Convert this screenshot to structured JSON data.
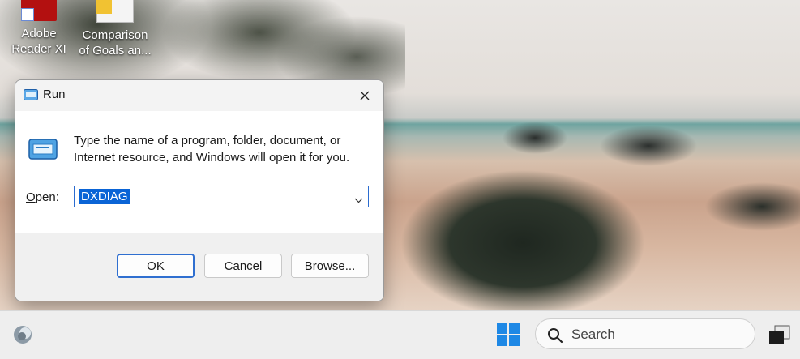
{
  "desktop": {
    "icons": [
      {
        "label_line1": "Adobe",
        "label_line2": "Reader XI",
        "icon": "pdf-file-icon"
      },
      {
        "label_line1": "Comparison",
        "label_line2": "of Goals an...",
        "icon": "spreadsheet-file-icon"
      }
    ]
  },
  "run_dialog": {
    "title": "Run",
    "description": "Type the name of a program, folder, document, or Internet resource, and Windows will open it for you.",
    "open_label_underlined": "O",
    "open_label_rest": "pen:",
    "input_value": "DXDIAG",
    "buttons": {
      "ok": "OK",
      "cancel": "Cancel",
      "browse": "Browse..."
    }
  },
  "taskbar": {
    "search_placeholder": "Search"
  },
  "colors": {
    "accent": "#0a64d6",
    "ok_border": "#2f6fd0",
    "taskbar_bg": "#eeeeee"
  }
}
